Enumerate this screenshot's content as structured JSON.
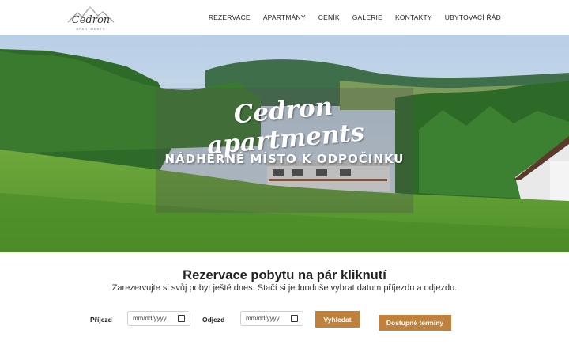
{
  "header": {
    "logo_text": "Cedron",
    "logo_sub": "APARTMENTS"
  },
  "nav": {
    "items": [
      "REZERVACE",
      "APARTMÁNY",
      "CENÍK",
      "GALERIE",
      "KONTAKTY",
      "UBYTOVACÍ ŘÁD"
    ]
  },
  "hero": {
    "title": "Cedron apartments",
    "subtitle": "NÁDHERNÉ MÍSTO K ODPOČINKU"
  },
  "booking": {
    "title": "Rezervace pobytu na pár kliknutí",
    "subtitle": "Zarezervujte si svůj pobyt ještě dnes. Stačí si jednoduše vybrat datum příjezdu a odjezdu.",
    "arrival_label": "Příjezd",
    "arrival_placeholder": "mm/dd/yyyy",
    "departure_label": "Odjezd",
    "departure_placeholder": "mm/dd/yyyy",
    "search_button": "Vyhledat",
    "available_button": "Dostupné termíny"
  },
  "colors": {
    "accent": "#c0813d",
    "text": "#222222"
  },
  "icons": {
    "calendar": "calendar-icon",
    "logo": "mountain-logo-icon"
  }
}
